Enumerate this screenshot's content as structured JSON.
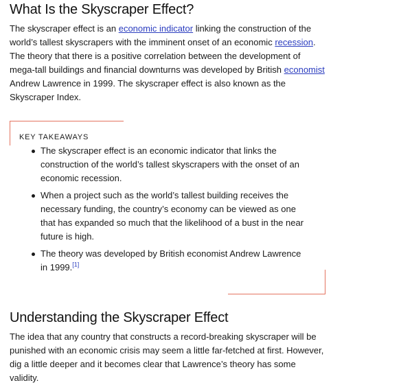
{
  "section1": {
    "heading": "What Is the Skyscraper Effect?",
    "para": {
      "t1": "The skyscraper effect is an ",
      "link1": "economic indicator",
      "t2": " linking the construction of the world’s tallest skyscrapers with the imminent onset of an economic ",
      "link2": "recession",
      "t3": ". The theory that there is a positive correlation between the development of mega-tall buildings and financial downturns was developed by British ",
      "link3": "economist",
      "t4": " Andrew Lawrence in 1999. The skyscraper effect is also known as the Skyscraper Index."
    }
  },
  "takeaways": {
    "title": "KEY TAKEAWAYS",
    "items": [
      "The skyscraper effect is an economic indicator that links the construction of the world’s tallest skyscrapers with the onset of an economic recession.",
      "When a project such as the world’s tallest building receives the necessary funding, the country’s economy can be viewed as one that has expanded so much that the likelihood of a bust in the near future is high.",
      "The theory was developed by British economist Andrew Lawrence in 1999."
    ],
    "ref": "[1]"
  },
  "section2": {
    "heading": "Understanding the Skyscraper Effect",
    "para": "The idea that any country that constructs a record-breaking skyscraper will be punished with an economic crisis may seem a little far-fetched at first. However, dig a little deeper and it becomes clear that Lawrence’s theory has some validity."
  },
  "colors": {
    "link": "#2a3cbf",
    "accent": "#e4735f",
    "text": "#1a1a1a"
  }
}
